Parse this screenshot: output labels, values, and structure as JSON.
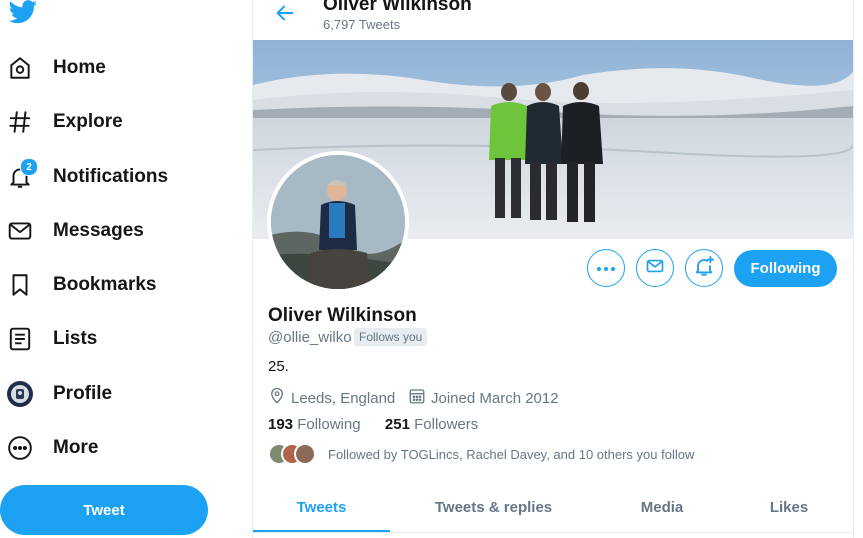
{
  "colors": {
    "accent": "#1da1f2",
    "text": "#14171a",
    "muted": "#657786",
    "border": "#e6ecf0"
  },
  "sidebar": {
    "logo_icon": "twitter-bird-icon",
    "items": [
      {
        "label": "Home",
        "icon": "home-icon"
      },
      {
        "label": "Explore",
        "icon": "hashtag-icon"
      },
      {
        "label": "Notifications",
        "icon": "bell-icon",
        "badge": "2"
      },
      {
        "label": "Messages",
        "icon": "envelope-icon"
      },
      {
        "label": "Bookmarks",
        "icon": "bookmark-icon"
      },
      {
        "label": "Lists",
        "icon": "list-icon"
      },
      {
        "label": "Profile",
        "icon": "avatar-icon"
      },
      {
        "label": "More",
        "icon": "more-circle-icon"
      }
    ],
    "tweet_button": "Tweet"
  },
  "header": {
    "name": "Oliver Wilkinson",
    "tweet_count": "6,797 Tweets"
  },
  "profile": {
    "display_name": "Oliver Wilkinson",
    "handle": "@ollie_wilko",
    "follows_you": "Follows you",
    "bio": "25.",
    "location": "Leeds, England",
    "joined": "Joined March 2012",
    "following_count": "193",
    "following_label": "Following",
    "followers_count": "251",
    "followers_label": "Followers",
    "followed_by": "Followed by TOGLincs, Rachel Davey, and 10 others you follow",
    "follow_button": "Following"
  },
  "tabs": [
    {
      "label": "Tweets",
      "active": true
    },
    {
      "label": "Tweets & replies",
      "active": false
    },
    {
      "label": "Media",
      "active": false
    },
    {
      "label": "Likes",
      "active": false
    }
  ]
}
